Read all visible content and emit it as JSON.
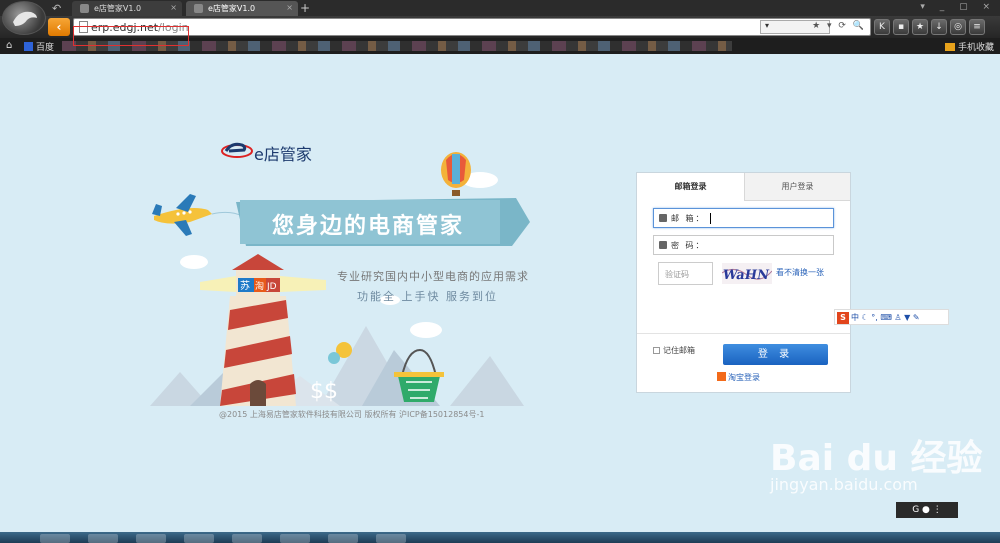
{
  "browser": {
    "tabs": [
      {
        "label": "e店管家V1.0",
        "active": false
      },
      {
        "label": "e店管家V1.0",
        "active": true
      }
    ],
    "url": {
      "host": "erp.edgj.net",
      "path": "/login"
    },
    "bookmarks": {
      "home_icon": "home-icon",
      "baidu": "百度",
      "mobile": "手机收藏"
    }
  },
  "brand": {
    "name": "e店管家"
  },
  "hero": {
    "banner": "您身边的电商管家",
    "tagline": "专业研究国内中小型电商的应用需求",
    "features": "功能全  上手快  服务到位",
    "sign_text": "JD",
    "sign_left": "苏",
    "sign_mid": "淘"
  },
  "login": {
    "tab_email": "邮箱登录",
    "tab_user": "用户登录",
    "email_label": "邮  箱：",
    "password_label": "密  码：",
    "captcha_placeholder": "验证码",
    "captcha_text": "WaHN",
    "captcha_refresh": "看不清换一张",
    "remember": "记住邮箱",
    "submit": "登 录",
    "taobao_login": "淘宝登录"
  },
  "ime_bar": {
    "label": "S",
    "mode": "中"
  },
  "footer": {
    "copyright": "@2015 上海易店管家软件科技有限公司 版权所有 沪ICP备15012854号-1"
  },
  "watermark": {
    "text": "Bai du 经验",
    "url": "jingyan.baidu.com"
  },
  "colors": {
    "accent": "#1a62c0",
    "brand": "#1c3a6e",
    "page_bg": "#d8ecf5"
  }
}
